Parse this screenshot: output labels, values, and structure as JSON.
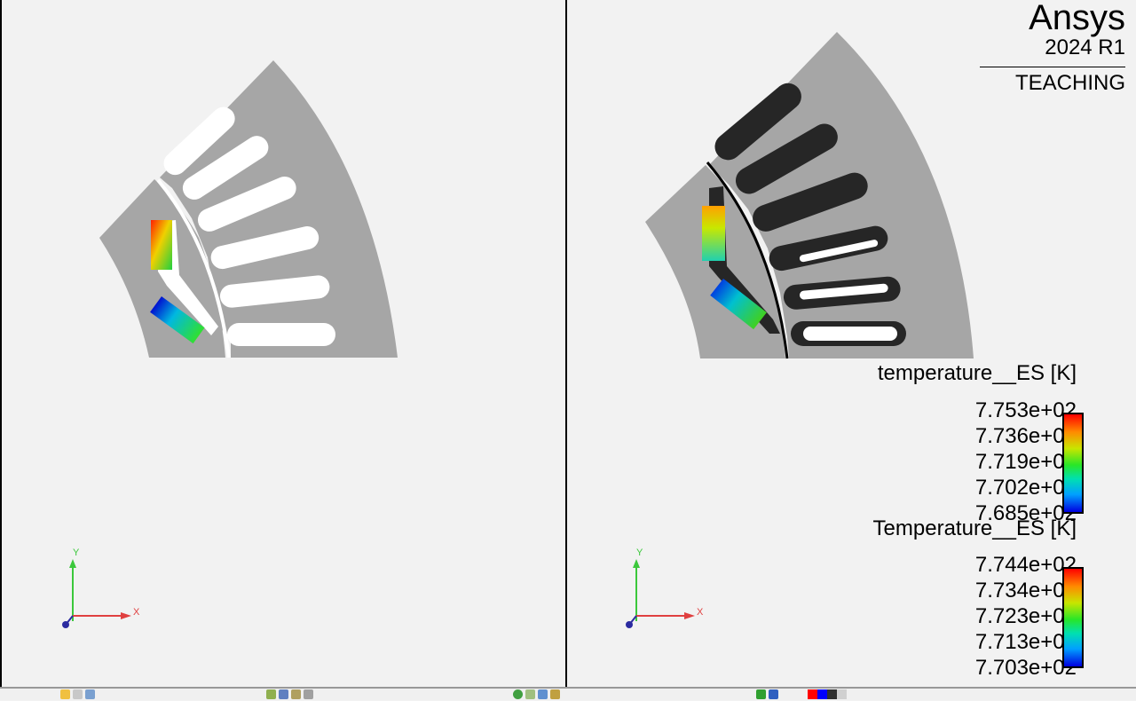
{
  "branding": {
    "name": "Ansys",
    "version": "2024 R1",
    "edition": "TEACHING"
  },
  "legends": [
    {
      "title": "temperature__ES [K]",
      "values": [
        "7.753e+02",
        "7.736e+02",
        "7.719e+02",
        "7.702e+02",
        "7.685e+02"
      ]
    },
    {
      "title": "Temperature__ES [K]",
      "values": [
        "7.744e+02",
        "7.734e+02",
        "7.723e+02",
        "7.713e+02",
        "7.703e+02"
      ]
    }
  ],
  "triad": {
    "x": "X",
    "y": "Y"
  },
  "colors": {
    "background": "#f2f2f2",
    "geometry": "#a6a6a6",
    "slot_fill": "#262626",
    "x_axis": "#e04040",
    "y_axis": "#3cc83c",
    "origin": "#2b2ba0"
  },
  "toolbar": {
    "icons": [
      "select-icon",
      "view-icon",
      "settings-icon",
      "mesh-icon",
      "refresh-icon",
      "plot-icon",
      "color-palette-icon"
    ]
  }
}
